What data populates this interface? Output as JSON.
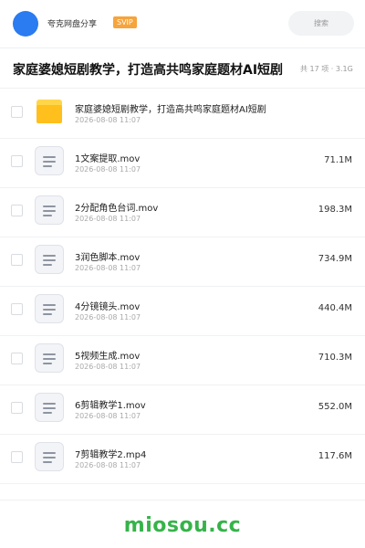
{
  "header": {
    "site_name": "夸克网盘分享",
    "badge": "SVIP",
    "search_placeholder": "搜索"
  },
  "share": {
    "title": "家庭婆媳短剧教学，打造高共鸣家庭题材AI短剧",
    "summary": "共 17 项 · 3.1G"
  },
  "files": [
    {
      "name": "家庭婆媳短剧教学，打造高共鸣家庭题材AI短剧",
      "date": "2026-08-08 11:07",
      "size": "",
      "icon": "folder-icon"
    },
    {
      "name": "1文案提取.mov",
      "date": "2026-08-08 11:07",
      "size": "71.1M",
      "icon": "file-icon"
    },
    {
      "name": "2分配角色台词.mov",
      "date": "2026-08-08 11:07",
      "size": "198.3M",
      "icon": "file-icon"
    },
    {
      "name": "3润色脚本.mov",
      "date": "2026-08-08 11:07",
      "size": "734.9M",
      "icon": "file-icon"
    },
    {
      "name": "4分镜镜头.mov",
      "date": "2026-08-08 11:07",
      "size": "440.4M",
      "icon": "file-icon"
    },
    {
      "name": "5视频生成.mov",
      "date": "2026-08-08 11:07",
      "size": "710.3M",
      "icon": "file-icon"
    },
    {
      "name": "6剪辑教学1.mov",
      "date": "2026-08-08 11:07",
      "size": "552.0M",
      "icon": "file-icon"
    },
    {
      "name": "7剪辑教学2.mp4",
      "date": "2026-08-08 11:07",
      "size": "117.6M",
      "icon": "file-icon"
    }
  ],
  "footer": {
    "brand": "miosou.cc"
  },
  "colors": {
    "accent": "#2b7bf1",
    "badge": "#f6a43b",
    "folder": "#ffbf1c",
    "brand": "#36b34a"
  }
}
